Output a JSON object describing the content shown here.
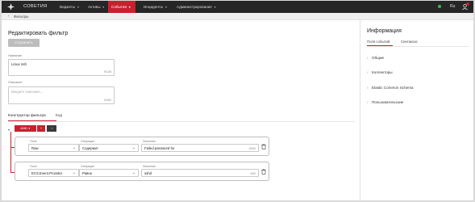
{
  "app": {
    "logo_text": "СОВЕТИЯ",
    "nav": [
      {
        "label": "Виджеты",
        "active": false
      },
      {
        "label": "Активы",
        "active": false
      },
      {
        "label": "События",
        "active": true
      },
      {
        "label": "Инциденты",
        "active": false
      },
      {
        "label": "Администрирование",
        "active": false
      }
    ],
    "lang": "Ru",
    "status_color": "#3bb54a",
    "accent": "#c8202f"
  },
  "breadcrumb": {
    "back_icon": "chevron-left-icon",
    "label": "Фильтры"
  },
  "page": {
    "title": "Редактировать фильтр",
    "save_label": "Сохранить",
    "name_label": "Название",
    "name_value": "Linux ssh",
    "name_counter": "9/128",
    "desc_label": "Описание",
    "desc_placeholder": "Введите описание...",
    "desc_counter": "0/300",
    "tabs": [
      {
        "label": "Конструктор фильтра",
        "active": true
      },
      {
        "label": "Код",
        "active": false
      }
    ]
  },
  "builder": {
    "operator_label": "AND",
    "add_label": "+",
    "not_label": "¬",
    "conditions": [
      {
        "field_label": "Поле",
        "field_value": "Raw",
        "op_label": "Операция",
        "op_value": "Содержит",
        "value_label": "Значение",
        "value_value": "Failed password for",
        "value_counter": "19/50"
      },
      {
        "field_label": "Поле",
        "field_value": "ECS.Event.Provider",
        "op_label": "Операция",
        "op_value": "Равно",
        "value_label": "Значение",
        "value_value": "sshd",
        "value_counter": "4/50"
      }
    ]
  },
  "info": {
    "title": "Информация",
    "tabs": [
      {
        "label": "Поля событий",
        "active": true
      },
      {
        "label": "Синтаксис",
        "active": false
      }
    ],
    "sections": [
      "Общие",
      "Коллекторы",
      "Elastic Common Schema",
      "Пользовательские"
    ]
  }
}
